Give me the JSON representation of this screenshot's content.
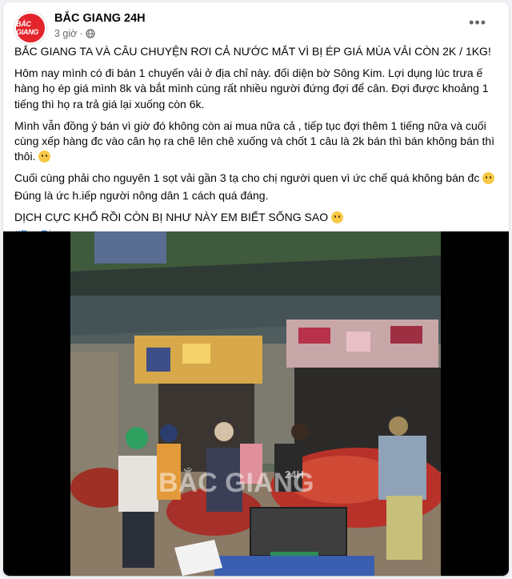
{
  "post": {
    "page_name": "BẮC GIANG 24H",
    "avatar_text": "BẮC GIANG",
    "time": "3 giờ",
    "separator": "·",
    "more_label": "•••",
    "paragraphs": [
      "BẮC GIANG TA VÀ CÂU CHUYỆN RƠI CẢ NƯỚC MẮT VÌ BỊ ÉP GIÁ MÙA VẢI CÒN 2K / 1KG!",
      "Hôm nay mình có đi bán 1 chuyến vải ở địa chỉ này. đối diện bờ Sông Kim. Lợi dụng lúc trưa ế hàng họ ép giá mình 8k và bắt mình cùng rất nhiều người đứng đợi để cân. Đợi được khoảng 1 tiếng thì họ ra trả giá lại xuống còn 6k.",
      "Mình vẫn đồng ý bán vì giờ đó không còn ai mua nữa cả , tiếp tục đợi thêm 1 tiếng nữa và cuối cùng xếp hàng đc vào cân họ ra chê lên chê xuống và chốt 1 câu là 2k bán thì bán không bán thì thôi.",
      "Cuối cùng phải cho nguyên 1 sọt vải gần 3 tạ cho chị người quen vì ức chế quá không bán đc",
      "Đúng là ức h.iếp người nông dân 1 cách quá đáng.",
      "DỊCH CỰC KHỔ RỒI CÒN BỊ NHƯ NÀY EM BIẾT SỐNG SAO"
    ],
    "hashtag": "#BacGiang"
  },
  "photo": {
    "watermark": "BẮC GIANG",
    "watermark_suffix": "24H",
    "colors": {
      "lychee": "#c0392b",
      "awning": "#6c7a6a",
      "ground": "#8a7a66"
    }
  },
  "icons": {
    "globe": "globe-icon",
    "emoji": "sad-face-icon",
    "more": "more-options-icon"
  }
}
